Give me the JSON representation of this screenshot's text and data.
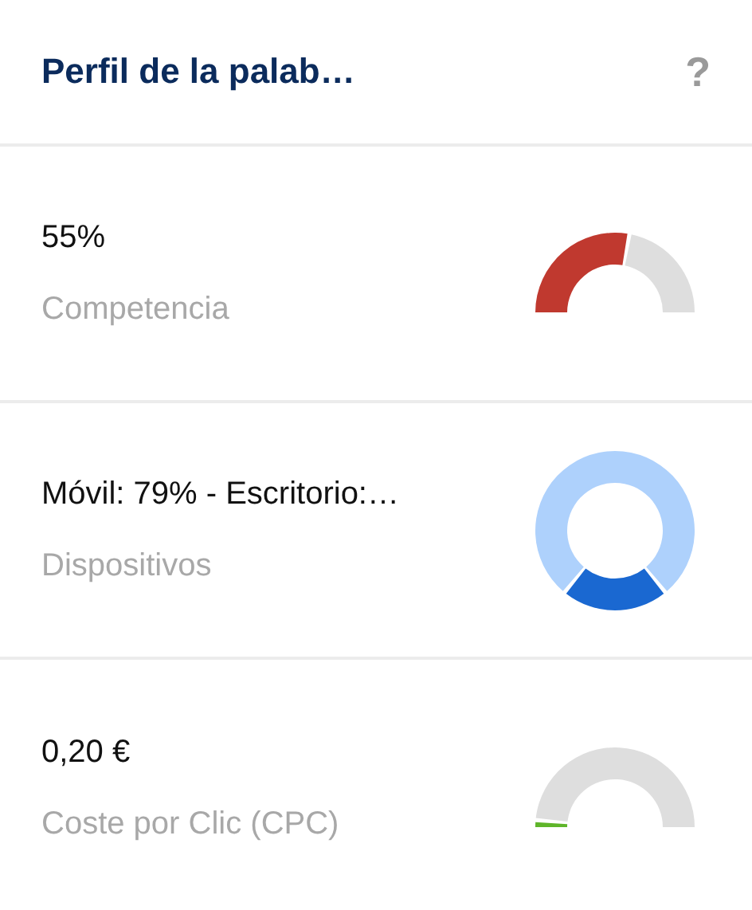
{
  "header": {
    "title": "Perfil de la palab…",
    "help": "?"
  },
  "metrics": [
    {
      "kind": "gauge",
      "value": "55%",
      "label": "Competencia",
      "color": "#c0392f"
    },
    {
      "kind": "donut",
      "value": "Móvil: 79% - Escritorio:…",
      "label": "Dispositivos",
      "color": "#1a68d1"
    },
    {
      "kind": "gauge",
      "value": "0,20 €",
      "label": "Coste por Clic (CPC)",
      "color": "#5fb52a"
    }
  ]
}
